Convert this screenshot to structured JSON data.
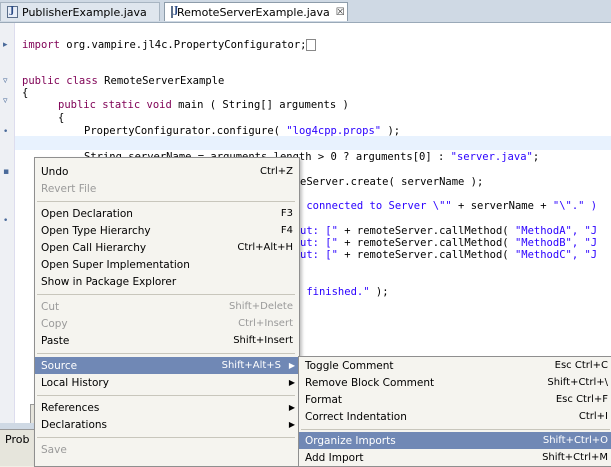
{
  "tabs": [
    {
      "label": "PublisherExample.java",
      "active": false
    },
    {
      "label": "RemoteServerExample.java",
      "active": true,
      "close_glyph": "☒"
    }
  ],
  "code": {
    "line1_kw": "import",
    "line1_rest": " org.vampire.jl4c.PropertyConfigurator;",
    "line2_kw": "public class",
    "line2_rest": " RemoteServerExample",
    "line3": "{",
    "line4_kw": "public static void",
    "line4_rest": " main ( String[] arguments )",
    "line5": "{",
    "line6_pre": "PropertyConfigurator.configure( ",
    "line6_str": "\"log4cpp.props\"",
    "line6_post": " );",
    "line7_pre": "String serverName = arguments.length > 0 ? arguments[0] : ",
    "line7_str": "\"server.java\"",
    "line7_post": ";",
    "line8": "eServer.create( serverName );",
    "line9_str": " connected to Server \\\"\" ",
    "line9_post": "+ serverName + ",
    "line9_str2": "\"\\\".\" )",
    "line10a_str": "ut: [\" ",
    "line10a_post": "+ remoteServer.callMethod( ",
    "line10a_str2": "\"MethodA\", \"J",
    "line10b_str": "ut: [\" ",
    "line10b_post": "+ remoteServer.callMethod( ",
    "line10b_str2": "\"MethodB\", \"J",
    "line10c_str": "ut: [\" ",
    "line10c_post": "+ remoteServer.callMethod( ",
    "line10c_str2": "\"MethodC\", \"J",
    "line11_str": " finished.\"",
    "line11_post": " );"
  },
  "context_menu": [
    {
      "label": "Undo",
      "accel": "Ctrl+Z",
      "disabled": false
    },
    {
      "label": "Revert File",
      "accel": "",
      "disabled": true
    },
    {
      "label": "Open Declaration",
      "accel": "F3",
      "disabled": false
    },
    {
      "label": "Open Type Hierarchy",
      "accel": "F4",
      "disabled": false
    },
    {
      "label": "Open Call Hierarchy",
      "accel": "Ctrl+Alt+H",
      "disabled": false
    },
    {
      "label": "Open Super Implementation",
      "accel": "",
      "disabled": false
    },
    {
      "label": "Show in Package Explorer",
      "accel": "",
      "disabled": false
    },
    {
      "label": "Cut",
      "accel": "Shift+Delete",
      "disabled": true
    },
    {
      "label": "Copy",
      "accel": "Ctrl+Insert",
      "disabled": true
    },
    {
      "label": "Paste",
      "accel": "Shift+Insert",
      "disabled": false
    },
    {
      "label": "Source",
      "accel": "Shift+Alt+S",
      "disabled": false,
      "selected": true,
      "submenu": true
    },
    {
      "label": "Local History",
      "accel": "",
      "disabled": false,
      "submenu": true
    },
    {
      "label": "References",
      "accel": "",
      "disabled": false,
      "submenu": true
    },
    {
      "label": "Declarations",
      "accel": "",
      "disabled": false,
      "submenu": true
    },
    {
      "label": "Save",
      "accel": "",
      "disabled": true
    }
  ],
  "source_submenu": [
    {
      "label": "Toggle Comment",
      "accel": "Esc Ctrl+C"
    },
    {
      "label": "Remove Block Comment",
      "accel": "Shift+Ctrl+\\"
    },
    {
      "label": "Format",
      "accel": "Esc Ctrl+F"
    },
    {
      "label": "Correct Indentation",
      "accel": "Ctrl+I"
    },
    {
      "label": "Organize Imports",
      "accel": "Shift+Ctrl+O",
      "selected": true
    },
    {
      "label": "Add Import",
      "accel": "Shift+Ctrl+M"
    }
  ],
  "bottom_panel": {
    "tab_label": "Prob"
  }
}
